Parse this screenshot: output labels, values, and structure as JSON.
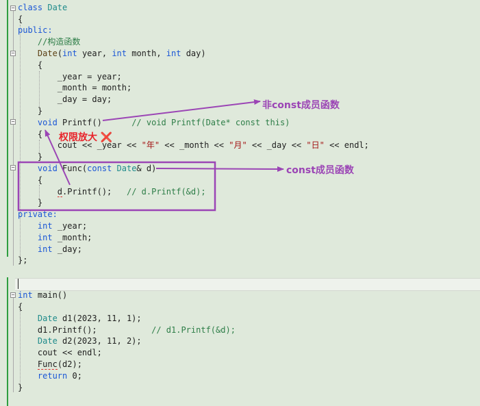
{
  "code": {
    "l1": {
      "kw": "class",
      "ty": "Date"
    },
    "l2": "{",
    "l3": "public:",
    "l4": "//构造函数",
    "l5": {
      "fn": "Date",
      "a": "(",
      "t1": "int",
      "p1": " year, ",
      "t2": "int",
      "p2": " month, ",
      "t3": "int",
      "p3": " day)"
    },
    "l6": "{",
    "l7": "_year = year;",
    "l8": "_month = month;",
    "l9": "_day = day;",
    "l10": "}",
    "l11": {
      "t": "void",
      "f": " Printf()",
      "c": "// void Printf(Date* const this)"
    },
    "l12": "{",
    "l13": {
      "a": "cout << _year << ",
      "s1": "\"年\"",
      "b": " << _month << ",
      "s2": "\"月\"",
      "c": " << _day << ",
      "s3": "\"日\"",
      "d": " << endl;"
    },
    "l14": "}",
    "l15": {
      "t": "void",
      "f": " Func(",
      "k": "const",
      "ty": " Date",
      "r": "& d)"
    },
    "l16": "{",
    "l17": {
      "d": "d",
      "m": ".Printf();",
      "c": "// d.Printf(&d);"
    },
    "l18": "}",
    "l19": "private:",
    "l20": {
      "t": "int",
      "v": " _year;"
    },
    "l21": {
      "t": "int",
      "v": " _month;"
    },
    "l22": {
      "t": "int",
      "v": " _day;"
    },
    "l23": "};",
    "l25": {
      "t": "int",
      "f": " main()"
    },
    "l26": "{",
    "l27": {
      "ty": "Date",
      "r": " d1(2023, 11, 1);"
    },
    "l28": {
      "r": "d1.Printf();",
      "c": "// d1.Printf(&d);"
    },
    "l29": {
      "ty": "Date",
      "r": " d2(2023, 11, 2);"
    },
    "l30": "cout << endl;",
    "l31": {
      "f": "Func",
      "r": "(d2);"
    },
    "l32": {
      "k": "return",
      "r": " 0;"
    },
    "l33": "}"
  },
  "annotations": {
    "nonconst": "非const成员函数",
    "constfn": "const成员函数",
    "amplify": "权限放大",
    "cross": "❌"
  },
  "colors": {
    "annotation": "#9b45b5",
    "warning": "#e8232a",
    "keyword": "#1a56d6",
    "comment": "#2d7d47",
    "background": "#dfe9db"
  }
}
